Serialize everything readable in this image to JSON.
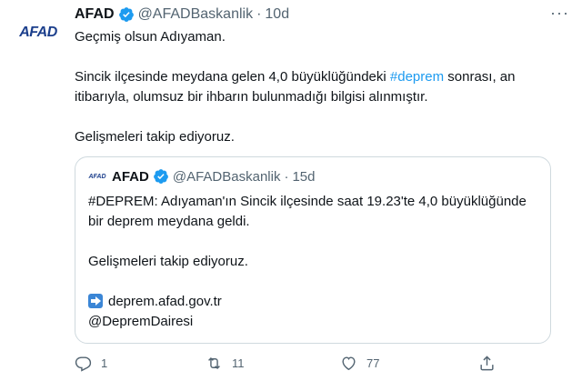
{
  "tweet": {
    "avatar_text": "AFAD",
    "name": "AFAD",
    "handle": "@AFADBaskanlik",
    "separator": "·",
    "time": "10d",
    "more": "···",
    "line1": "Geçmiş olsun Adıyaman.",
    "line2_a": "Sincik ilçesinde meydana gelen 4,0 büyüklüğündeki ",
    "hashtag": "#deprem",
    "line2_b": " sonrası, an itibarıyla, olumsuz bir ihbarın bulunmadığı bilgisi alınmıştır.",
    "line3": "Gelişmeleri takip ediyoruz."
  },
  "quote": {
    "logo_text": "AFAD",
    "name": "AFAD",
    "handle": "@AFADBaskanlik",
    "separator": "·",
    "time": "15d",
    "line1": "#DEPREM: Adıyaman'ın Sincik ilçesinde saat 19.23'te 4,0 büyüklüğünde bir deprem meydana geldi.",
    "line2": "Gelişmeleri takip ediyoruz.",
    "link": "deprem.afad.gov.tr",
    "mention": "@DepremDairesi"
  },
  "actions": {
    "reply_count": "1",
    "retweet_count": "11",
    "like_count": "77",
    "share_count": ""
  },
  "colors": {
    "accent": "#1d9bf0",
    "muted": "#536471",
    "border": "#cfd9de",
    "brand": "#1c3f8c"
  }
}
